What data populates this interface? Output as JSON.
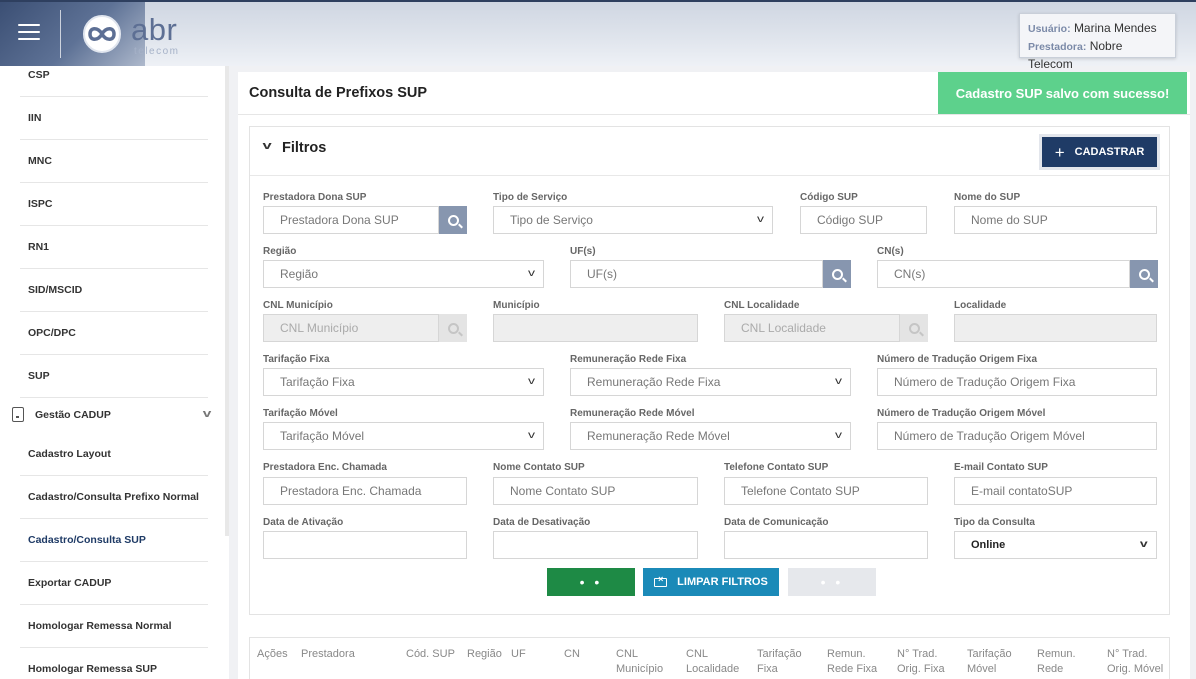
{
  "header": {
    "logo_text": "abr",
    "logo_sub": "telecom",
    "user_label": "Usuário:",
    "user_name": "Marina Mendes",
    "provider_label": "Prestadora:",
    "provider_name": "Nobre Telecom"
  },
  "sidebar": {
    "items_top": [
      "CSP",
      "IIN",
      "MNC",
      "ISPC",
      "RN1",
      "SID/MSCID",
      "OPC/DPC",
      "SUP"
    ],
    "group_label": "Gestão CADUP",
    "items_group": [
      "Cadastro Layout",
      "Cadastro/Consulta Prefixo Normal",
      "Cadastro/Consulta SUP",
      "Exportar CADUP",
      "Homologar Remessa Normal",
      "Homologar Remessa SUP"
    ]
  },
  "page": {
    "title": "Consulta de Prefixos SUP",
    "toast": "Cadastro SUP salvo com sucesso!"
  },
  "filters": {
    "title": "Filtros",
    "add_button": "CADASTRAR",
    "fields": {
      "prestadora_dona": {
        "label": "Prestadora Dona SUP",
        "placeholder": "Prestadora Dona SUP"
      },
      "tipo_servico": {
        "label": "Tipo de Serviço",
        "placeholder": "Tipo de Serviço"
      },
      "codigo_sup": {
        "label": "Código SUP",
        "placeholder": "Código SUP"
      },
      "nome_sup": {
        "label": "Nome do SUP",
        "placeholder": "Nome do SUP"
      },
      "regiao": {
        "label": "Região",
        "placeholder": "Região"
      },
      "ufs": {
        "label": "UF(s)",
        "placeholder": "UF(s)"
      },
      "cns": {
        "label": "CN(s)",
        "placeholder": "CN(s)"
      },
      "cnl_municipio": {
        "label": "CNL Município",
        "placeholder": "CNL Município"
      },
      "municipio": {
        "label": "Município",
        "placeholder": ""
      },
      "cnl_localidade": {
        "label": "CNL Localidade",
        "placeholder": "CNL Localidade"
      },
      "localidade": {
        "label": "Localidade",
        "placeholder": ""
      },
      "tarifacao_fixa": {
        "label": "Tarifação Fixa",
        "placeholder": "Tarifação Fixa"
      },
      "remun_rede_fixa": {
        "label": "Remuneração Rede Fixa",
        "placeholder": "Remuneração Rede Fixa"
      },
      "num_trad_fixa": {
        "label": "Número de Tradução Origem Fixa",
        "placeholder": "Número de Tradução Origem Fixa"
      },
      "tarifacao_movel": {
        "label": "Tarifação Móvel",
        "placeholder": "Tarifação Móvel"
      },
      "remun_rede_movel": {
        "label": "Remuneração Rede Móvel",
        "placeholder": "Remuneração Rede Móvel"
      },
      "num_trad_movel": {
        "label": "Número de Tradução Origem Móvel",
        "placeholder": "Número de Tradução Origem Móvel"
      },
      "prestadora_enc": {
        "label": "Prestadora Enc. Chamada",
        "placeholder": "Prestadora Enc. Chamada"
      },
      "nome_contato": {
        "label": "Nome Contato SUP",
        "placeholder": "Nome Contato SUP"
      },
      "telefone_contato": {
        "label": "Telefone Contato SUP",
        "placeholder": "Telefone Contato SUP"
      },
      "email_contato": {
        "label": "E-mail Contato SUP",
        "placeholder": "E-mail contatoSUP"
      },
      "data_ativacao": {
        "label": "Data de Ativação",
        "placeholder": ""
      },
      "data_desativacao": {
        "label": "Data de Desativação",
        "placeholder": ""
      },
      "data_comunicacao": {
        "label": "Data de Comunicação",
        "placeholder": ""
      },
      "tipo_consulta": {
        "label": "Tipo da Consulta",
        "value": "Online"
      }
    },
    "btn_search": "• •",
    "btn_clear": "LIMPAR FILTROS",
    "btn_export": "• •"
  },
  "table": {
    "headers": [
      "Ações",
      "Prestadora",
      "Cód. SUP",
      "Região",
      "UF",
      "CN",
      "CNL Município",
      "CNL Localidade",
      "Tarifação Fixa",
      "Remun. Rede Fixa",
      "N° Trad. Orig. Fixa",
      "Tarifação Móvel",
      "Remun. Rede",
      "N° Trad. Orig. Móvel"
    ]
  }
}
